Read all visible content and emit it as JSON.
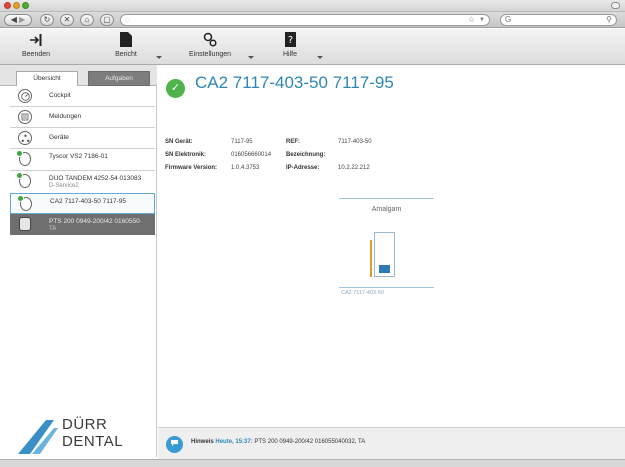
{
  "browser": {
    "back_icon": "back-arrow-icon",
    "forward_icon": "forward-arrow-icon",
    "reload_icon": "reload-icon",
    "stop_icon": "stop-icon",
    "home_icon": "home-icon",
    "url_icon": "page-icon",
    "bookmark_icon": "star-icon",
    "search_icon": "magnifier-icon"
  },
  "toolbar": {
    "items": [
      {
        "label": "Beenden",
        "icon": "exit-icon"
      },
      {
        "label": "Bericht",
        "icon": "document-icon"
      },
      {
        "label": "Einstellungen",
        "icon": "settings-icon"
      },
      {
        "label": "Hilfe",
        "icon": "help-icon"
      }
    ]
  },
  "sidebar": {
    "tabs": [
      "Übersicht",
      "Aufgaben"
    ],
    "nav": [
      {
        "label": "Cockpit",
        "icon": "clock-icon"
      },
      {
        "label": "Meldungen",
        "icon": "messages-icon"
      },
      {
        "label": "Geräte",
        "icon": "network-icon"
      }
    ],
    "devices": [
      {
        "line1": "Tyscor VS2 7186-01",
        "line2": "",
        "status": "ok"
      },
      {
        "line1": "DUO TANDEM 4252-54 013083",
        "line2": "D-Service2",
        "status": "ok"
      },
      {
        "line1": "CA2 7117-403-50 7117-95",
        "line2": "",
        "status": "ok"
      },
      {
        "line1": "PTS 200 0949-200/42 0160550·",
        "line2": "TA",
        "status": "none"
      }
    ],
    "logo_line1": "DÜRR",
    "logo_line2": "DENTAL"
  },
  "main": {
    "title": "CA2 7117-403-50 7117-95",
    "info": {
      "sn_geraet_label": "SN Gerät:",
      "sn_geraet_value": "7117-95",
      "ref_label": "REF:",
      "ref_value": "7117-403-50",
      "sn_elektronik_label": "SN Elektronik:",
      "sn_elektronik_value": "016056660014",
      "bezeichnung_label": "Bezeichnung:",
      "bezeichnung_value": "",
      "firmware_label": "Firmware Version:",
      "firmware_value": "1.0.4.3753",
      "ip_label": "IP-Adresse:",
      "ip_value": "10.2.22.212"
    },
    "amalgam": {
      "title": "Amalgam",
      "fill_fraction": 0.22,
      "caption": "CA2 7117-403-50"
    }
  },
  "status": {
    "label": "Hinweis",
    "time": "Heute, 15:37:",
    "message": "PTS 200 0949-200/42 016055040032, TA"
  },
  "colors": {
    "accent": "#2f87b5",
    "ok": "#4db34a",
    "amalgam_fill": "#2e7ab2",
    "amalgam_side": "#e39a2d"
  }
}
